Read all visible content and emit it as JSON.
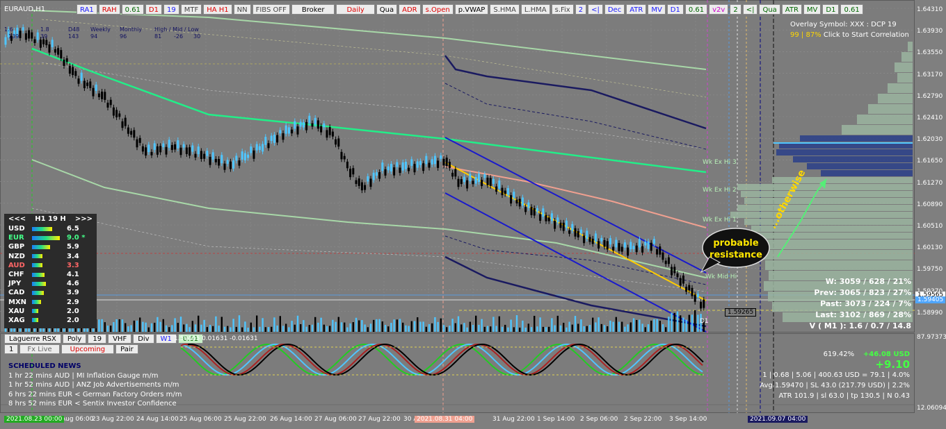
{
  "symbol": "EURAUD,H1",
  "toolbar": [
    "RA1",
    "RAH",
    "0.61",
    "D1",
    "19",
    "MTF",
    "HA H1",
    "NN",
    "FIBS OFF",
    "Broker",
    "Daily",
    "Qua",
    "ADR",
    "s.Open",
    "p.VWAP",
    "S.HMA",
    "L.HMA",
    "s.Fix",
    "2",
    "<|",
    "Dec",
    "ATR",
    "MV",
    "D1",
    "0.61",
    "v2v",
    "2",
    "<|",
    "Qua",
    "ATR",
    "MV",
    "D1",
    "0.61"
  ],
  "toolbar_colors": [
    "#1a1aff",
    "#e00000",
    "#006600",
    "#e00000",
    "#1a1aff",
    "#444",
    "#e00000",
    "#444",
    "#444",
    "#000",
    "#e00000",
    "#000",
    "#e00000",
    "#e00000",
    "#000",
    "#444",
    "#444",
    "#444",
    "#1a1aff",
    "#1a1aff",
    "#1a1aff",
    "#1a1aff",
    "#1a1aff",
    "#1a1aff",
    "#006600",
    "#cc00cc",
    "#006600",
    "#006600",
    "#006600",
    "#006600",
    "#006600",
    "#006600",
    "#006600"
  ],
  "strip": {
    "a": "1.6",
    "b": "1.8",
    "c": "D48",
    "d": "Weekly",
    "e": "Monthly",
    "f": "High / Mid / Low",
    "g": "39",
    "h": "143",
    "i": "139",
    "j": "94",
    "k": "96",
    "l": "81",
    "m": "-26",
    "n": "30"
  },
  "overlay": {
    "line1": "Overlay Symbol: XXX : DCP 19",
    "pct": "99 | 87%",
    "line2": "Click to Start Correlation"
  },
  "stats": [
    "W: 3059 / 628 / 21%",
    "Prev: 3065 / 823 / 27%",
    "Past: 3073 / 224 / 7%",
    "Last: 3102 / 869 / 28%",
    "V ( M1 ): 1.6 / 0.7 / 14.8"
  ],
  "strength": {
    "header": {
      "left": "<<<",
      "mid": "H1 19 H",
      "right": ">>>"
    },
    "rows": [
      {
        "code": "USD",
        "value": "6.5",
        "bar": 0.65,
        "color": "#ffffff"
      },
      {
        "code": "EUR",
        "value": "9.0 *",
        "bar": 0.9,
        "color": "#44ff88"
      },
      {
        "code": "GBP",
        "value": "5.9",
        "bar": 0.59,
        "color": "#ffffff"
      },
      {
        "code": "NZD",
        "value": "3.4",
        "bar": 0.34,
        "color": "#ffffff"
      },
      {
        "code": "AUD",
        "value": "3.3",
        "bar": 0.33,
        "color": "#ff6666"
      },
      {
        "code": "CHF",
        "value": "4.1",
        "bar": 0.41,
        "color": "#ffffff"
      },
      {
        "code": "JPY",
        "value": "4.6",
        "bar": 0.46,
        "color": "#ffffff"
      },
      {
        "code": "CAD",
        "value": "3.9",
        "bar": 0.39,
        "color": "#ffffff"
      },
      {
        "code": "MXN",
        "value": "2.9",
        "bar": 0.29,
        "color": "#ffffff"
      },
      {
        "code": "XAU",
        "value": "2.0",
        "bar": 0.2,
        "color": "#ffffff"
      },
      {
        "code": "XAG",
        "value": "2.0",
        "bar": 0.2,
        "color": "#ffffff"
      }
    ]
  },
  "levels": {
    "wk3": "Wk Ex Hi 3",
    "wk2": "Wk Ex Hi 2",
    "wk1": "Wk Ex Hi 1",
    "wkmid": "Wk Mid Hi",
    "d1": "D1"
  },
  "callout": {
    "line1": "probable",
    "line2": "resistance",
    "arrow_text": "...otherwise"
  },
  "price_labels": [
    "1.64310",
    "1.63930",
    "1.63550",
    "1.63170",
    "1.62790",
    "1.62410",
    "1.62030",
    "1.61650",
    "1.61270",
    "1.60890",
    "1.60510",
    "1.60130",
    "1.59750",
    "1.59370",
    "1.58990"
  ],
  "current_price": "1.59405",
  "price_tag2": "1.59565",
  "box_price": "1.59265",
  "sub": {
    "buttons1": [
      "Laguerre RSX",
      "Poly",
      "19",
      "VHF",
      "Div",
      "W1",
      "0.61"
    ],
    "buttons2": [
      "1",
      "Fx Live",
      "Upcoming",
      "Pair"
    ],
    "info": "1.59405 0.01631 -0.01631",
    "axis_top": "87.97373",
    "axis_bottom": "12.06094"
  },
  "news": {
    "title": "SCHEDULED NEWS",
    "items": [
      "1 hr 22 mins  AUD  |  MI Inflation Gauge m/m",
      "1 hr 52 mins  AUD  |  ANZ Job Advertisements m/m",
      "6 hrs 22 mins  EUR  <  German Factory Orders m/m",
      "8 hrs 52 mins  EUR  <  Sentix Investor Confidence"
    ]
  },
  "account": {
    "pct": "619.42%",
    "usd": "+46.08 USD",
    "big": "+9.10",
    "line1": "1  |  0.68  |  5.06  |  400.63 USD = 79.1  |  4.0%",
    "line2": "Avg 1.59470  |  SL 43.0 (217.79 USD)  |  2.2%",
    "line3": "ATR 101.9  |  sl 63.0  |  tp 130.5  |  N 0.43"
  },
  "time_labels": [
    "Aug 06:00",
    "23 Aug 22:00",
    "24 Aug 14:00",
    "25 Aug 06:00",
    "25 Aug 22:00",
    "26 Aug 14:00",
    "27 Aug 06:00",
    "27 Aug 22:00",
    "30 A",
    "31 Aug 22:00",
    "1 Sep 14:00",
    "2 Sep 06:00",
    "2 Sep 22:00",
    "3 Sep 14:00"
  ],
  "time_tags": {
    "start": "2021.08.23 00:00",
    "mid": "2021.08.31 04:00",
    "end": "2021.09.07 04:00"
  },
  "colors": {
    "bg": "#7c7c7c",
    "ema_green": "#22ee88",
    "channel": "#1a1acc",
    "trend": "#ffcc00",
    "salmon": "#f0a090"
  }
}
